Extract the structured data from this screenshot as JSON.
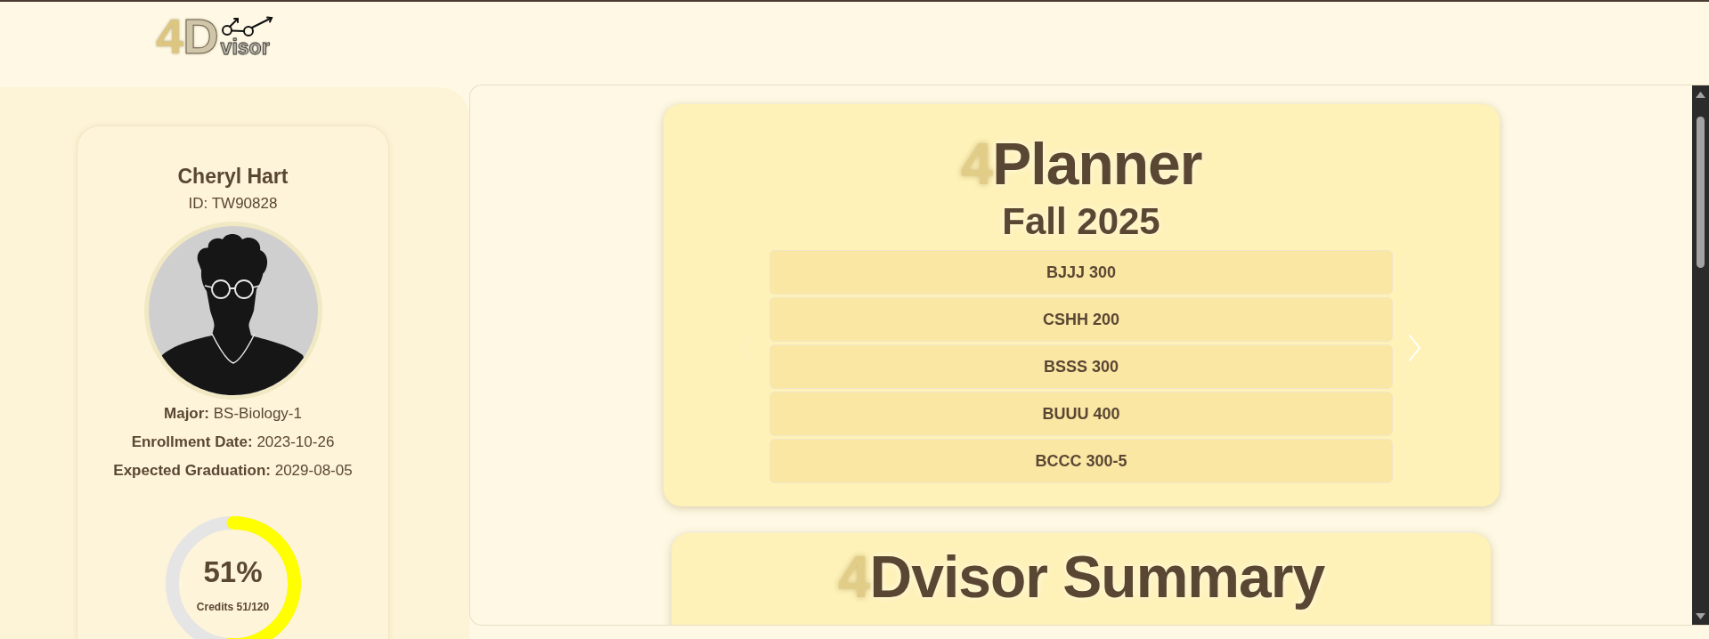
{
  "logo": {
    "accent": "4",
    "initial": "D",
    "tail": "visor"
  },
  "profile": {
    "name": "Cheryl Hart",
    "id": "ID: TW90828",
    "details": [
      "**Major:** BS-Biology-1",
      "**Enrollment Date:** 2023-10-26",
      "**Expected Graduation:** 2029-08-05"
    ],
    "progress": {
      "percent": "51%",
      "caption": "Credits 51/120",
      "level": 0.51
    }
  },
  "planner": {
    "title_accent": "4",
    "title": "Planner",
    "term": "Fall 2025",
    "arrows": [
      {
        "kind": "prev",
        "disabled": true
      },
      {
        "kind": "next",
        "disabled": false
      }
    ],
    "courses": [
      "BJJJ 300",
      "CSHH 200",
      "BSSS 300",
      "BUUU 400",
      "BCCC 300-5"
    ]
  },
  "summary": {
    "title_accent": "4",
    "title": "Dvisor Summary"
  }
}
